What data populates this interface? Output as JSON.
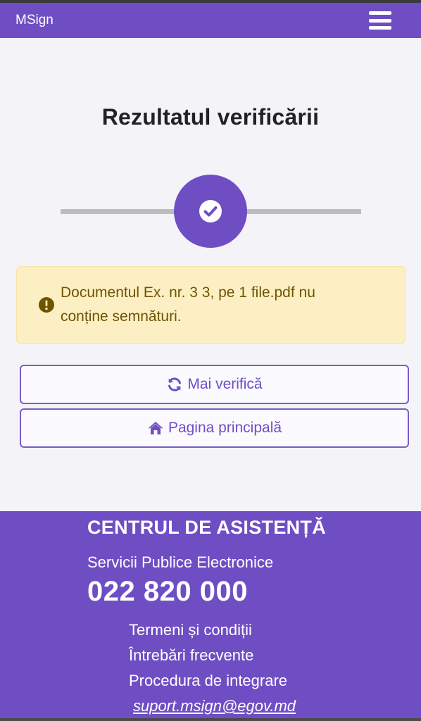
{
  "navbar": {
    "brand": "MSign",
    "menu_icon": "hamburger-menu-icon"
  },
  "page": {
    "title": "Rezultatul verificării"
  },
  "stepper": {
    "status": "completed",
    "icon": "check-circle-icon"
  },
  "alert": {
    "icon": "exclamation-circle-icon",
    "line1": "Documentul Ex. nr. 3 3, pe 1 file.pdf nu",
    "line2": "conține semnături."
  },
  "actions": {
    "verify_again": {
      "label": "Mai verifică",
      "icon": "refresh-icon"
    },
    "home": {
      "label": "Pagina principală",
      "icon": "home-icon"
    }
  },
  "footer": {
    "heading": "CENTRUL DE ASISTENȚĂ",
    "service": "Servicii Publice Electronice",
    "phone": "022 820 000",
    "links": [
      "Termeni și condiții",
      "Întrebări frecvente",
      "Procedura de integrare"
    ],
    "email": "suport.msign@egov.md"
  },
  "colors": {
    "primary": "#6f4ec4",
    "alert_bg": "#fcefc4",
    "alert_text": "#6e5400"
  }
}
